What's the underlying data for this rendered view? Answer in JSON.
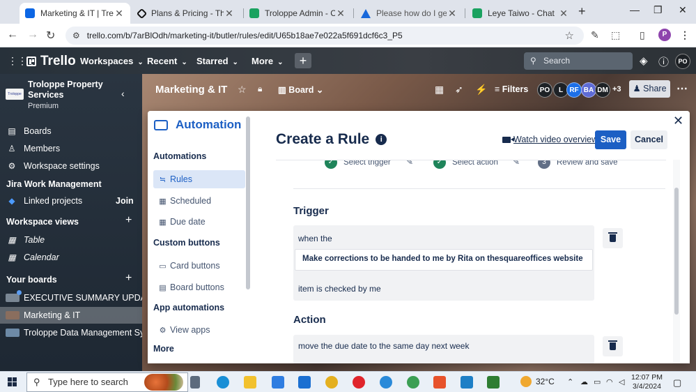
{
  "browser": {
    "tabs": [
      {
        "title": "Marketing & IT | Trello",
        "active": true
      },
      {
        "title": "Plans & Pricing - The Squ",
        "active": false
      },
      {
        "title": "Troloppe Admin - Chat",
        "active": false
      },
      {
        "title": "Please how do I get to m",
        "active": false
      },
      {
        "title": "Leye Taiwo - Chat",
        "active": false
      }
    ],
    "url": "trello.com/b/7arBlOdh/marketing-it/butler/rules/edit/U65b18ae7e022a5f691dcf6c3_P5",
    "profile_initial": "P"
  },
  "trello_header": {
    "brand": "Trello",
    "menus": [
      "Workspaces",
      "Recent",
      "Starred",
      "More"
    ],
    "search_placeholder": "Search",
    "avatar": "PO"
  },
  "sidebar": {
    "workspace_name": "Troloppe Property Services",
    "workspace_plan": "Premium",
    "logo_text": "Troloppe",
    "items": [
      {
        "label": "Boards",
        "icon": "boards-icon"
      },
      {
        "label": "Members",
        "icon": "members-icon"
      },
      {
        "label": "Workspace settings",
        "icon": "gear-icon"
      }
    ],
    "jira_heading": "Jira Work Management",
    "linked_projects": "Linked projects",
    "join_label": "Join",
    "views_heading": "Workspace views",
    "views": [
      {
        "label": "Table",
        "icon": "table-icon"
      },
      {
        "label": "Calendar",
        "icon": "calendar-icon"
      }
    ],
    "boards_heading": "Your boards",
    "boards": [
      {
        "label": "EXECUTIVE SUMMARY UPDATE",
        "color": "#7a8794"
      },
      {
        "label": "Marketing & IT",
        "color": "#8a6e5e"
      },
      {
        "label": "Troloppe Data Management Sy...",
        "color": "#6d8aa6"
      }
    ]
  },
  "board": {
    "title": "Marketing & IT",
    "view": "Board",
    "filters_label": "Filters",
    "members": [
      {
        "initials": "PO",
        "color": "#1d2125"
      },
      {
        "initials": "L",
        "color": "#1d2125"
      },
      {
        "initials": "RF",
        "color": "#1c6fe8"
      },
      {
        "initials": "BA",
        "color": "#5e6bd6"
      },
      {
        "initials": "DM",
        "color": "#1d2125"
      }
    ],
    "more_members": "+3",
    "share_label": "Share"
  },
  "automation": {
    "title": "Automation",
    "section_automations": "Automations",
    "items_main": [
      {
        "label": "Rules",
        "icon": "rules-icon",
        "selected": true
      },
      {
        "label": "Scheduled",
        "icon": "calendar-icon",
        "selected": false
      },
      {
        "label": "Due date",
        "icon": "calendar-icon",
        "selected": false
      }
    ],
    "section_custom": "Custom buttons",
    "items_custom": [
      {
        "label": "Card buttons",
        "icon": "card-icon"
      },
      {
        "label": "Board buttons",
        "icon": "board-icon"
      }
    ],
    "section_app": "App automations",
    "items_app": [
      {
        "label": "View apps",
        "icon": "gear-icon"
      }
    ],
    "section_more": "More"
  },
  "rule_editor": {
    "title": "Create a Rule",
    "watch_video": "Watch video overview",
    "save_label": "Save",
    "cancel_label": "Cancel",
    "steps": [
      {
        "label": "Select trigger",
        "done": true
      },
      {
        "label": "Select action",
        "done": true
      },
      {
        "label": "Review and save",
        "done": false,
        "number": "3"
      }
    ],
    "trigger_heading": "Trigger",
    "trigger_prefix": "when the",
    "trigger_item": "Make corrections to be handed to me by Rita on thesquareoffices website",
    "trigger_suffix": "item is checked by me",
    "action_heading": "Action",
    "action_text": "move the due date to the same day next week"
  },
  "taskbar": {
    "search_placeholder": "Type here to search",
    "temperature": "32°C",
    "time": "12:07 PM",
    "date": "3/4/2024"
  }
}
